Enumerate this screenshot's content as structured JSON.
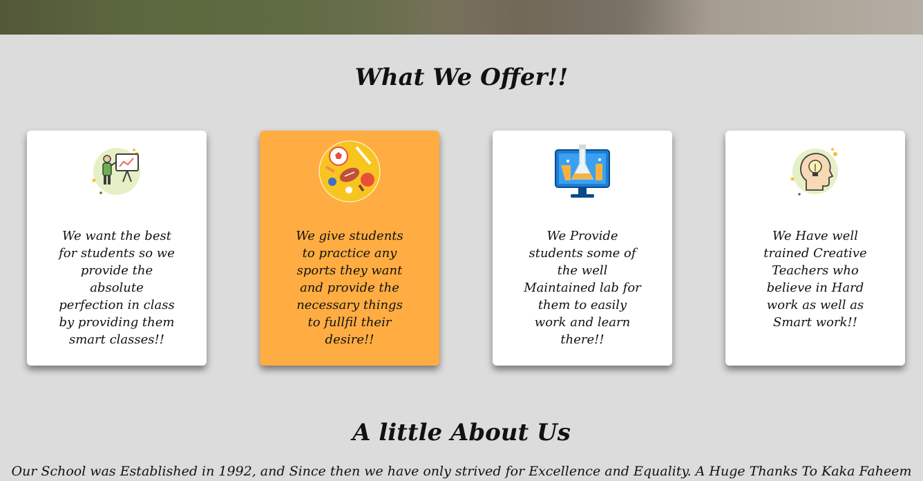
{
  "offer": {
    "title": "What We Offer!!",
    "cards": [
      {
        "icon": "teacher-board-icon",
        "text": "We want the best for students so we provide the absolute perfection in class by providing them smart classes!!",
        "highlighted": false
      },
      {
        "icon": "sports-icon",
        "text": "We give students to practice any sports they want and provide the necessary things to fullfil their desire!!",
        "highlighted": true
      },
      {
        "icon": "lab-monitor-icon",
        "text": "We Provide students some of the well Maintained lab for them to easily work and learn there!!",
        "highlighted": false
      },
      {
        "icon": "idea-head-icon",
        "text": "We Have well trained Creative Teachers who believe in Hard work as well as Smart work!!",
        "highlighted": false
      }
    ]
  },
  "about": {
    "title": "A little About Us",
    "text": "Our School was Established in 1992, and Since then we have only strived for Excellence and Equality. A Huge Thanks To Kaka Faheem"
  },
  "colors": {
    "background": "#dcdcdc",
    "card": "#ffffff",
    "card_highlight": "#ffad42"
  }
}
